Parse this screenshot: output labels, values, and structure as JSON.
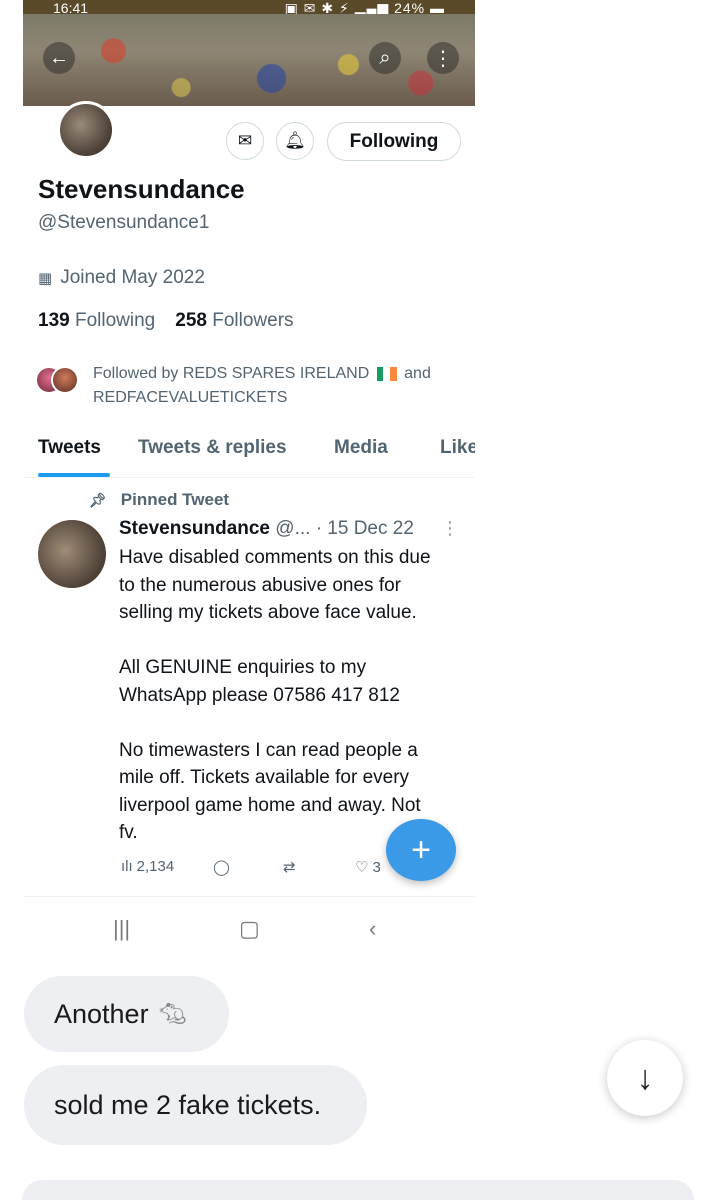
{
  "status_bar": {
    "time": "16:41",
    "battery": "24%"
  },
  "profile": {
    "display_name": "Stevensundance",
    "handle": "@Stevensundance1",
    "joined": "Joined May 2022",
    "following_count": "139",
    "following_label": "Following",
    "followers_count": "258",
    "followers_label": "Followers",
    "following_button": "Following",
    "followed_by_prefix": "Followed by REDS SPARES IRELAND",
    "followed_by_suffix": "and",
    "followed_by_second": "REDFACEVALUETICKETS"
  },
  "tabs": [
    {
      "label": "Tweets"
    },
    {
      "label": "Tweets & replies"
    },
    {
      "label": "Media"
    },
    {
      "label": "Like"
    }
  ],
  "pinned_tweet": {
    "pinned_label": "Pinned Tweet",
    "author": "Stevensundance",
    "handle_trunc": "@...",
    "date": "· 15 Dec 22",
    "lines": [
      "Have disabled comments on this due",
      "to the numerous abusive ones  for",
      "selling my tickets above face value.",
      "",
      "All GENUINE enquiries to my",
      "WhatsApp please 07586 417 812",
      "",
      "No timewasters I can read people a",
      "mile off. Tickets available for every",
      "liverpool game home and away. Not",
      "fv."
    ],
    "views": "2,134",
    "likes": "3"
  },
  "chat": {
    "message_1": "Another",
    "message_2": "sold me 2 fake tickets."
  },
  "colors": {
    "accent": "#1d9bf0",
    "fab": "#3a9ae8",
    "muted_text": "#536471",
    "bubble": "#edeff2"
  },
  "icons": [
    "back-arrow-icon",
    "search-icon",
    "more-vertical-icon",
    "mail-icon",
    "bell-plus-icon",
    "calendar-icon",
    "pin-icon",
    "views-icon",
    "reply-icon",
    "retweet-icon",
    "heart-icon",
    "plus-icon",
    "rat-icon",
    "arrow-down-icon"
  ]
}
